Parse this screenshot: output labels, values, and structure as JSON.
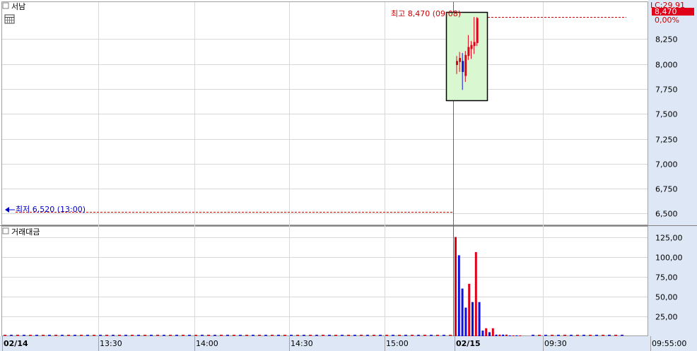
{
  "chart_data": [
    {
      "type": "candlestick",
      "panel": "price",
      "title": "서남",
      "y_ticks": [
        "8,250",
        "8,000",
        "7,750",
        "7,500",
        "7,250",
        "7,000",
        "6,750",
        "6,500"
      ],
      "y_tick_values": [
        8250,
        8000,
        7750,
        7500,
        7250,
        7000,
        6750,
        6500
      ],
      "ylim": [
        6390,
        8620
      ],
      "last_price": "8,470",
      "change_pct": "0,00%",
      "upper_limit": "LC:29.91",
      "high_label": "최고 8,470 (09:08)",
      "low_label": "최저 6,520 (13:00)",
      "high_value": 8470,
      "low_value": 6520,
      "x_ticks": [
        "02/14",
        "13:30",
        "14:00",
        "14:30",
        "15:00",
        "02/15",
        "09:30",
        "09:55:00"
      ],
      "candles": [
        {
          "o": 7990,
          "h": 8080,
          "l": 7900,
          "c": 8030
        },
        {
          "o": 8020,
          "h": 8120,
          "l": 7920,
          "c": 8060
        },
        {
          "o": 8030,
          "h": 8110,
          "l": 7740,
          "c": 7920
        },
        {
          "o": 7880,
          "h": 8130,
          "l": 7820,
          "c": 8090
        },
        {
          "o": 8080,
          "h": 8290,
          "l": 8040,
          "c": 8170
        },
        {
          "o": 8150,
          "h": 8230,
          "l": 8050,
          "c": 8190
        },
        {
          "o": 8180,
          "h": 8470,
          "l": 8100,
          "c": 8220
        },
        {
          "o": 8210,
          "h": 8470,
          "l": 8180,
          "c": 8460
        }
      ],
      "colors": {
        "up": "#e0001a",
        "down": "#1010e0",
        "highlight_fill": "#d9f7d0",
        "high_line": "#cc0000",
        "low_line": "#cc0000",
        "label_red": "#cc0000",
        "label_blue": "#0000cc"
      }
    },
    {
      "type": "bar",
      "panel": "volume",
      "title": "거래대금",
      "y_ticks": [
        "125,00",
        "100,00",
        "75,00",
        "50,00",
        "25,00"
      ],
      "y_tick_values": [
        125,
        100,
        75,
        50,
        25
      ],
      "ylim": [
        0,
        138
      ],
      "bars": [
        {
          "v": 125,
          "dir": "up"
        },
        {
          "v": 102,
          "dir": "down"
        },
        {
          "v": 60,
          "dir": "down"
        },
        {
          "v": 36,
          "dir": "down"
        },
        {
          "v": 66,
          "dir": "up"
        },
        {
          "v": 43,
          "dir": "down"
        },
        {
          "v": 106,
          "dir": "up"
        },
        {
          "v": 43,
          "dir": "down"
        },
        {
          "v": 7,
          "dir": "down"
        },
        {
          "v": 10,
          "dir": "up"
        },
        {
          "v": 5,
          "dir": "down"
        },
        {
          "v": 10,
          "dir": "up"
        },
        {
          "v": 2,
          "dir": "down"
        },
        {
          "v": 2,
          "dir": "up"
        },
        {
          "v": 2,
          "dir": "down"
        },
        {
          "v": 2,
          "dir": "up"
        },
        {
          "v": 1,
          "dir": "down"
        },
        {
          "v": 1,
          "dir": "up"
        },
        {
          "v": 1,
          "dir": "down"
        },
        {
          "v": 1,
          "dir": "up"
        }
      ]
    }
  ]
}
